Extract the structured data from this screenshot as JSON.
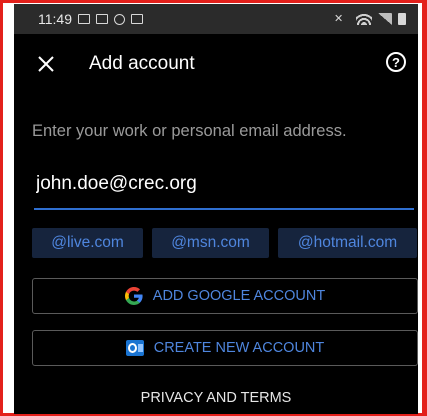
{
  "status_bar": {
    "time": "11:49",
    "icons": [
      "gallery-icon",
      "cloud-icon",
      "alarm-icon",
      "image-icon",
      "mute-icon",
      "wifi-icon",
      "signal-icon",
      "battery-icon"
    ]
  },
  "app_bar": {
    "title": "Add account",
    "close_icon": "close-icon",
    "help_label": "?"
  },
  "form": {
    "prompt": "Enter your work or personal email address.",
    "email_value": "john.doe@crec.org"
  },
  "domain_chips": [
    "@live.com",
    "@msn.com",
    "@hotmail.com"
  ],
  "buttons": {
    "google": "ADD GOOGLE ACCOUNT",
    "create": "CREATE NEW ACCOUNT"
  },
  "footer": {
    "privacy": "PRIVACY AND TERMS"
  },
  "colors": {
    "accent": "#4f86de",
    "underline": "#2f6fd1",
    "chip_bg": "#16243d",
    "background": "#000000",
    "frame": "#e3201b"
  }
}
